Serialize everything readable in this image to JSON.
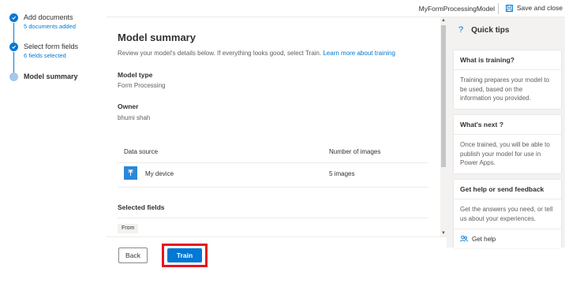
{
  "stepper": {
    "steps": [
      {
        "title": "Add documents",
        "subtitle": "5 documents added"
      },
      {
        "title": "Select form fields",
        "subtitle": "6 fields selected"
      },
      {
        "title": "Model summary"
      }
    ]
  },
  "topbar": {
    "model_name": "MyFormProcessingModel",
    "save_label": "Save and close"
  },
  "main": {
    "title": "Model summary",
    "intro": "Review your model's details below. If everything looks good, select Train.",
    "learn_more": "Learn more about training",
    "model_type_label": "Model type",
    "model_type_value": "Form Processing",
    "owner_label": "Owner",
    "owner_value": "bhumi shah",
    "table": {
      "headers": [
        "Data source",
        "Number of images"
      ],
      "rows": [
        {
          "source": "My device",
          "images": "5 images"
        }
      ]
    },
    "selected_fields_label": "Selected fields",
    "selected_fields": [
      "From"
    ]
  },
  "footer": {
    "back_label": "Back",
    "train_label": "Train"
  },
  "tips": {
    "title": "Quick tips",
    "icon_glyph": "?",
    "cards": [
      {
        "title": "What is training?",
        "body": "Training prepares your model to be used, based on the information you provided."
      },
      {
        "title": "What's next ?",
        "body": "Once trained, you will be able to publish your model for use in Power Apps."
      },
      {
        "title": "Get help or send feedback",
        "body": "Get the answers you need, or tell us about your experiences.",
        "link": "Get help"
      }
    ]
  },
  "colors": {
    "accent": "#0078d4",
    "highlight": "#e81123",
    "panel_bg": "#f3f2f1"
  }
}
